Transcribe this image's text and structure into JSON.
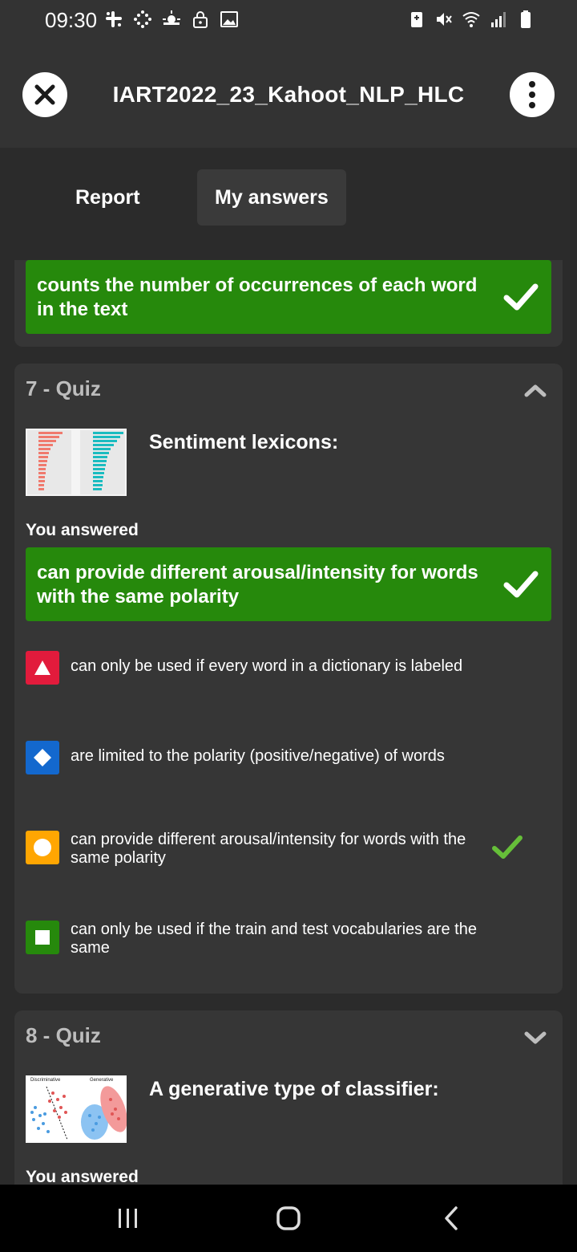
{
  "status_bar": {
    "time": "09:30",
    "left_icons": [
      "slack-icon",
      "grid-icon",
      "weather-icon",
      "lock-icon",
      "image-icon"
    ],
    "right_icons": [
      "battery-saver-icon",
      "mute-icon",
      "wifi-icon",
      "signal-icon",
      "battery-icon"
    ]
  },
  "header": {
    "title": "IART2022_23_Kahoot_NLP_HLC",
    "close_icon": "close-icon",
    "more_icon": "more-vertical-icon"
  },
  "tabs": [
    {
      "label": "Report",
      "active": false
    },
    {
      "label": "My answers",
      "active": true
    }
  ],
  "prev_card": {
    "answer": "counts the number of occurrences of each word in the text",
    "correct": true
  },
  "quiz7": {
    "header": "7 - Quiz",
    "expanded": true,
    "question": "Sentiment lexicons:",
    "you_answered_label": "You answered",
    "your_answer": "can provide different arousal/intensity for words with the same polarity",
    "options": [
      {
        "shape": "triangle",
        "color": "#e21b3c",
        "text": "can only be used if every word in a dictionary is labeled",
        "correct": false
      },
      {
        "shape": "diamond",
        "color": "#1368ce",
        "text": "are limited to the polarity (positive/negative) of words",
        "correct": false
      },
      {
        "shape": "circle",
        "color": "#ffa602",
        "text": "can provide different arousal/intensity for words with the same polarity",
        "correct": true
      },
      {
        "shape": "square",
        "color": "#26890c",
        "text": "can only be used if the train and test vocabularies are the same",
        "correct": false
      }
    ]
  },
  "quiz8": {
    "header": "8 - Quiz",
    "expanded": false,
    "question": "A generative type of classifier:",
    "thumb_labels": [
      "Discriminative",
      "Generative"
    ],
    "you_answered_label": "You answered"
  },
  "colors": {
    "correct_green": "#26890c",
    "check_green": "#66bf39",
    "card_bg": "#363636",
    "page_bg": "#2b2b2b"
  },
  "nav_bar": [
    "recent-apps-icon",
    "home-icon",
    "back-icon"
  ]
}
